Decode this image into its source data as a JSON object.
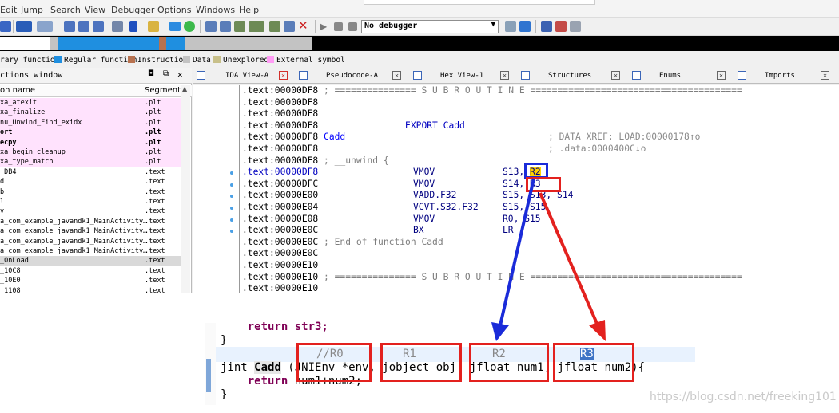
{
  "menubar": {
    "items": [
      "Edit",
      "Jump",
      "Search",
      "View",
      "Debugger",
      "Options",
      "Windows",
      "Help"
    ]
  },
  "toolbar": {
    "debugger_select": "No debugger"
  },
  "legend": {
    "items": [
      {
        "label": "rary function",
        "color": "#8dd9e8"
      },
      {
        "label": "Regular function",
        "color": "#1f8fe0"
      },
      {
        "label": "Instruction",
        "color": "#b8724f"
      },
      {
        "label": "Data",
        "color": "#c3c3c3"
      },
      {
        "label": "Unexplored",
        "color": "#c8c08a"
      },
      {
        "label": "External symbol",
        "color": "#ff9cf5"
      }
    ]
  },
  "functions_window": {
    "title": "ctions window",
    "col_name": "on name",
    "col_segment": "Segment",
    "rows": [
      {
        "name": "xa_atexit",
        "segment": ".plt",
        "style": "pink"
      },
      {
        "name": "xa_finalize",
        "segment": ".plt",
        "style": "pink"
      },
      {
        "name": "nu_Unwind_Find_exidx",
        "segment": ".plt",
        "style": "pink"
      },
      {
        "name": "ort",
        "segment": ".plt",
        "style": "pink-bold"
      },
      {
        "name": "ecpy",
        "segment": ".plt",
        "style": "pink-bold"
      },
      {
        "name": "xa_begin_cleanup",
        "segment": ".plt",
        "style": "pink"
      },
      {
        "name": "xa_type_match",
        "segment": ".plt",
        "style": "pink"
      },
      {
        "name": "_DB4",
        "segment": ".text",
        "style": ""
      },
      {
        "name": "d",
        "segment": ".text",
        "style": ""
      },
      {
        "name": "b",
        "segment": ".text",
        "style": ""
      },
      {
        "name": "l",
        "segment": ".text",
        "style": ""
      },
      {
        "name": "v",
        "segment": ".text",
        "style": ""
      },
      {
        "name": "a_com_example_javandk1_MainActivity…",
        "segment": ".text",
        "style": ""
      },
      {
        "name": "a_com_example_javandk1_MainActivity…",
        "segment": ".text",
        "style": ""
      },
      {
        "name": "a_com_example_javandk1_MainActivity…",
        "segment": ".text",
        "style": ""
      },
      {
        "name": "a_com_example_javandk1_MainActivity…",
        "segment": ".text",
        "style": ""
      },
      {
        "name": "_OnLoad",
        "segment": ".text",
        "style": "sel"
      },
      {
        "name": "_10C8",
        "segment": ".text",
        "style": ""
      },
      {
        "name": "_10E0",
        "segment": ".text",
        "style": ""
      },
      {
        "name": "_1108",
        "segment": ".text",
        "style": ""
      }
    ]
  },
  "tabs": [
    {
      "label": "IDA View-A"
    },
    {
      "label": "Pseudocode-A"
    },
    {
      "label": "Hex View-1"
    },
    {
      "label": "Structures"
    },
    {
      "label": "Enums"
    },
    {
      "label": "Imports"
    }
  ],
  "disasm": {
    "lines": [
      {
        "addr": ".text:00000DF8",
        "rest": " ; =============== S U B R O U T I N E =======================================",
        "kind": "cmt"
      },
      {
        "addr": ".text:00000DF8",
        "rest": "",
        "kind": "plain"
      },
      {
        "addr": ".text:00000DF8",
        "rest": "",
        "kind": "plain"
      },
      {
        "addr": ".text:00000DF8",
        "rest": "                EXPORT Cadd",
        "kind": "blue"
      },
      {
        "addr": ".text:00000DF8",
        "rest": " Cadd",
        "kind": "label",
        "xref": "; DATA XREF: LOAD:00000178↑o"
      },
      {
        "addr": ".text:00000DF8",
        "rest": "",
        "kind": "plain",
        "xref": "; .data:0000400C↓o"
      },
      {
        "addr": ".text:00000DF8",
        "rest": " ; __unwind {",
        "kind": "cmt-unwind"
      },
      {
        "addr": ".text:00000DF8",
        "mnem": "VMOV",
        "ops": "S13, ",
        "hl": "R2",
        "bp": true
      },
      {
        "addr": ".text:00000DFC",
        "mnem": "VMOV",
        "ops": "S14, ",
        "hl2": "R3",
        "bp": true
      },
      {
        "addr": ".text:00000E00",
        "mnem": "VADD.F32",
        "ops": "S15, S13, S14",
        "bp": true
      },
      {
        "addr": ".text:00000E04",
        "mnem": "VCVT.S32.F32",
        "ops": "S15, S15",
        "bp": true
      },
      {
        "addr": ".text:00000E08",
        "mnem": "VMOV",
        "ops": "R0, S15",
        "bp": true
      },
      {
        "addr": ".text:00000E0C",
        "mnem": "BX",
        "ops": "LR",
        "bp": true
      },
      {
        "addr": ".text:00000E0C",
        "rest": " ; End of function Cadd",
        "kind": "cmt"
      },
      {
        "addr": ".text:00000E0C",
        "rest": "",
        "kind": "plain"
      },
      {
        "addr": ".text:00000E10",
        "rest": "",
        "kind": "plain"
      },
      {
        "addr": ".text:00000E10",
        "rest": " ; =============== S U B R O U T I N E =======================================",
        "kind": "cmt"
      },
      {
        "addr": ".text:00000E10",
        "rest": "",
        "kind": "plain"
      }
    ]
  },
  "editor": {
    "line_return_top": "    return str3;",
    "line_brace_close": "}",
    "reg_labels": [
      "//R0",
      "R1",
      "R2",
      "R3"
    ],
    "sig_prefix": "jint ",
    "sig_name": "Cadd",
    "sig_params": " (JNIEnv *env, jobject obj, jfloat num1, jfloat num2){",
    "line_return": "    return num1+num2;",
    "line_end": "}"
  },
  "watermark": "https://blog.csdn.net/freeking101",
  "colors": {
    "annotation_red": "#e3211e",
    "annotation_blue": "#1a2bd9",
    "highlight_yellow": "#ffd200"
  }
}
